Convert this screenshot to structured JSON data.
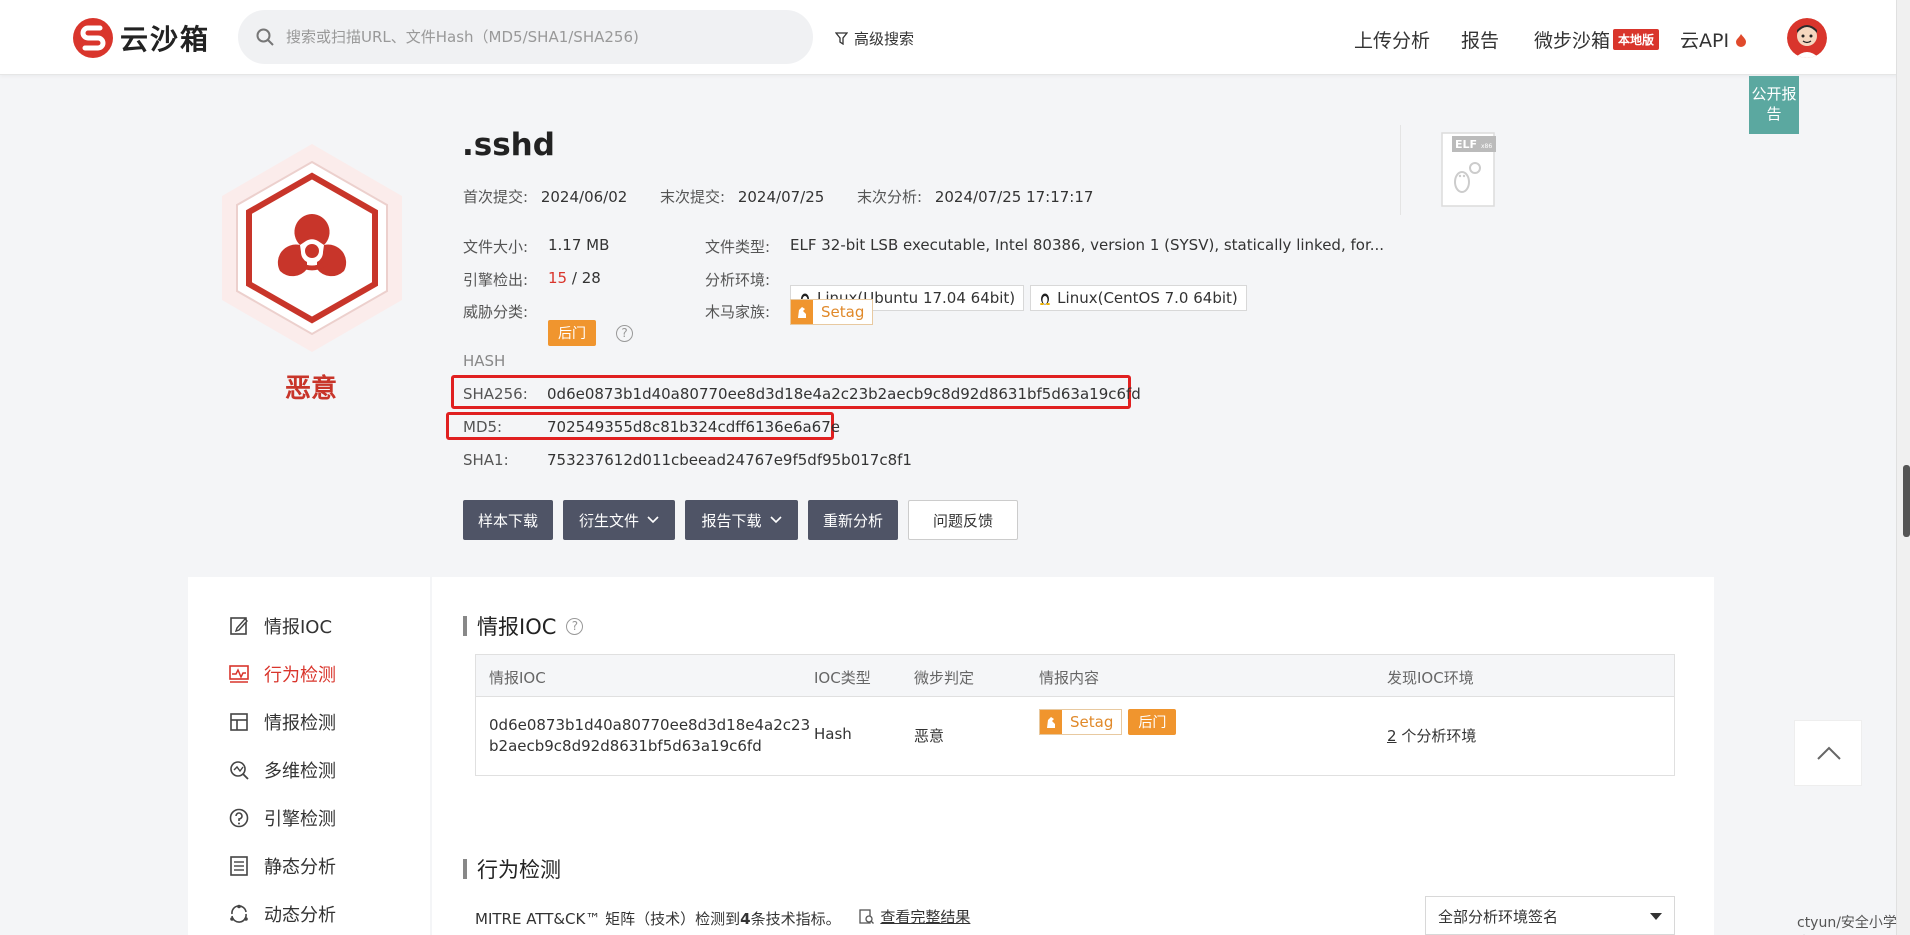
{
  "header": {
    "logo_text": "云沙箱",
    "search_placeholder": "搜索或扫描URL、文件Hash（MD5/SHA1/SHA256)",
    "advanced_search": "高级搜索",
    "nav": {
      "upload": "上传分析",
      "report": "报告",
      "weibu_sandbox": "微步沙箱",
      "local_badge": "本地版",
      "cloud_api": "云API"
    }
  },
  "public_report": "公开报告",
  "sample": {
    "name": ".sshd",
    "verdict": "恶意",
    "first_submit_label": "首次提交:",
    "first_submit": "2024/06/02",
    "last_submit_label": "末次提交:",
    "last_submit": "2024/07/25",
    "last_analysis_label": "末次分析:",
    "last_analysis": "2024/07/25 17:17:17",
    "file_size_label": "文件大小:",
    "file_size": "1.17 MB",
    "file_type_label": "文件类型:",
    "file_type": "ELF 32-bit LSB executable, Intel 80386, version 1 (SYSV), statically linked, for...",
    "engine_label": "引擎检出:",
    "engine_hits": "15",
    "engine_total": "/ 28",
    "env_label": "分析环境:",
    "env1": "Linux(Ubuntu 17.04 64bit)",
    "env2": "Linux(CentOS 7.0 64bit)",
    "threat_label": "威胁分类:",
    "threat_tag": "后门",
    "family_label": "木马家族:",
    "family": "Setag",
    "file_icon_label": "ELF",
    "file_icon_sub": "x86"
  },
  "hash": {
    "header": "HASH",
    "sha256_label": "SHA256:",
    "sha256": "0d6e0873b1d40a80770ee8d3d18e4a2c23b2aecb9c8d92d8631bf5d63a19c6fd",
    "md5_label": "MD5:",
    "md5": "702549355d8c81b324cdff6136e6a67e",
    "sha1_label": "SHA1:",
    "sha1": "753237612d011cbeead24767e9f5df95b017c8f1"
  },
  "actions": {
    "download_sample": "样本下载",
    "derived_files": "衍生文件",
    "download_report": "报告下载",
    "reanalyze": "重新分析",
    "feedback": "问题反馈"
  },
  "sidebar": {
    "items": [
      {
        "label": "情报IOC"
      },
      {
        "label": "行为检测"
      },
      {
        "label": "情报检测"
      },
      {
        "label": "多维检测"
      },
      {
        "label": "引擎检测"
      },
      {
        "label": "静态分析"
      },
      {
        "label": "动态分析"
      }
    ]
  },
  "ioc_section": {
    "title": "情报IOC",
    "columns": [
      "情报IOC",
      "IOC类型",
      "微步判定",
      "情报内容",
      "发现IOC环境"
    ],
    "row": {
      "ioc_line1": "0d6e0873b1d40a80770ee8d3d18e4a2c23",
      "ioc_line2": "b2aecb9c8d92d8631bf5d63a19c6fd",
      "type": "Hash",
      "verdict": "恶意",
      "family": "Setag",
      "tag": "后门",
      "env_count": "2",
      "env_text": "个分析环境"
    }
  },
  "behavior_section": {
    "title": "行为检测",
    "mitre_prefix": "MITRE ATT&CK™ 矩阵（技术）检测到",
    "mitre_count": "4",
    "mitre_suffix": "条技术指标。",
    "view_full": "查看完整结果",
    "env_select": "全部分析环境签名"
  },
  "watermark": "ctyun/安全小学生",
  "colors": {
    "malicious": "#d9352c",
    "tag_orange": "#f0952e",
    "button_dark": "#4f5466",
    "public_report": "#5ba8a0"
  }
}
